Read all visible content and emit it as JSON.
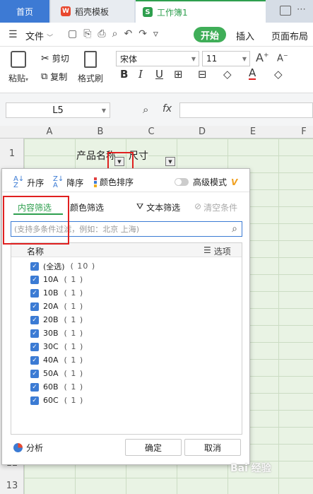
{
  "tabs": {
    "home": "首页",
    "template": "稻壳模板",
    "workbook": "工作簿1"
  },
  "menu": {
    "file": "文件",
    "start": "开始",
    "insert": "插入",
    "layout": "页面布局"
  },
  "ribbon": {
    "paste": "粘贴",
    "cut": "剪切",
    "copy": "复制",
    "format_painter": "格式刷",
    "font_name": "宋体",
    "font_size": "11"
  },
  "formula": {
    "cell_ref": "L5",
    "fx": "fx"
  },
  "sheet": {
    "columns": [
      "A",
      "B",
      "C",
      "D",
      "E",
      "F"
    ],
    "rows": [
      "1",
      "12",
      "13"
    ],
    "cell_b1": "产品名称",
    "cell_c1": "尺寸"
  },
  "filter": {
    "sort_asc": "升序",
    "sort_desc": "降序",
    "sort_color": "颜色排序",
    "advanced_mode": "高级模式",
    "tab_content": "内容筛选",
    "tab_color": "颜色筛选",
    "text_filter": "文本筛选",
    "clear": "清空条件",
    "search_placeholder": "(支持多条件过滤，例如：北京 上海)",
    "list_header": "名称",
    "options": "选项",
    "items": [
      {
        "label": "(全选)",
        "count": "( 10 )"
      },
      {
        "label": "10A",
        "count": "( 1 )"
      },
      {
        "label": "10B",
        "count": "( 1 )"
      },
      {
        "label": "20A",
        "count": "( 1 )"
      },
      {
        "label": "20B",
        "count": "( 1 )"
      },
      {
        "label": "30B",
        "count": "( 1 )"
      },
      {
        "label": "30C",
        "count": "( 1 )"
      },
      {
        "label": "40A",
        "count": "( 1 )"
      },
      {
        "label": "50A",
        "count": "( 1 )"
      },
      {
        "label": "60B",
        "count": "( 1 )"
      },
      {
        "label": "60C",
        "count": "( 1 )"
      }
    ],
    "analyze": "分析",
    "ok": "确定",
    "cancel": "取消"
  },
  "watermark": "Bai 经验"
}
